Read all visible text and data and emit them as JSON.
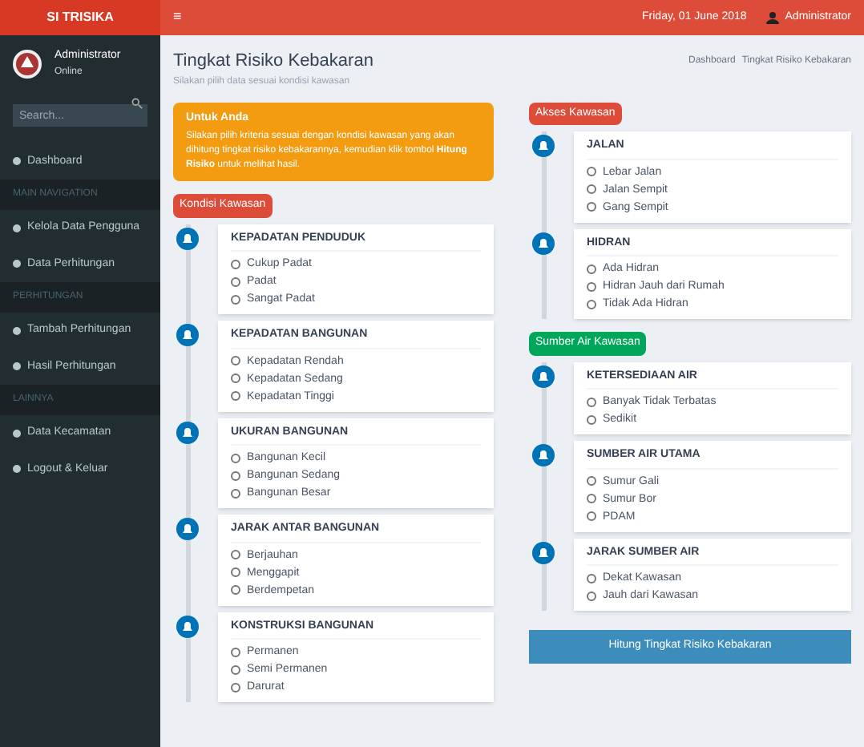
{
  "header": {
    "logo": "SI TRISIKA",
    "menu_toggle": "≡",
    "date": "Friday, 01 June 2018",
    "user": "Administrator"
  },
  "sidebar": {
    "user_name": "Administrator",
    "user_status": "Online",
    "search": {
      "placeholder": "Search..."
    },
    "items": [
      {
        "kind": "item",
        "label": "Dashboard",
        "selected": false
      },
      {
        "kind": "section",
        "label": "MAIN NAVIGATION"
      },
      {
        "kind": "item",
        "label": "Kelola Data Pengguna",
        "selected": false
      },
      {
        "kind": "item",
        "label": "Data Perhitungan",
        "selected": false
      },
      {
        "kind": "section",
        "label": "PERHITUNGAN"
      },
      {
        "kind": "item",
        "label": "Tambah Perhitungan",
        "selected": false
      },
      {
        "kind": "item",
        "label": "Hasil Perhitungan",
        "selected": false
      },
      {
        "kind": "section",
        "label": "LAINNYA"
      },
      {
        "kind": "item",
        "label": "Data Kecamatan",
        "selected": false
      },
      {
        "kind": "item",
        "label": "Logout & Keluar",
        "selected": false
      }
    ]
  },
  "page": {
    "title": "Tingkat Risiko Kebakaran",
    "subtitle": "Silakan pilih data sesuai kondisi kawasan",
    "breadcrumb": [
      "Dashboard",
      "Tingkat Risiko Kebakaran"
    ]
  },
  "alert": {
    "title": "Untuk Anda",
    "text": "Silakan pilih kriteria sesuai dengan kondisi kawasan yang akan dihitung tingkat risiko kebakarannya, kemudian klik tombol **Hitung Risiko** untuk melihat hasil."
  },
  "left_groups": [
    {
      "label": "Kondisi Kawasan",
      "color": "#dd4b39",
      "cards": [
        {
          "title": "KEPADATAN PENDUDUK",
          "options": [
            {
              "label": "Cukup Padat",
              "selected": false
            },
            {
              "label": "Padat",
              "selected": false
            },
            {
              "label": "Sangat Padat",
              "selected": false
            }
          ]
        },
        {
          "title": "KEPADATAN BANGUNAN",
          "options": [
            {
              "label": "Kepadatan Rendah",
              "selected": false
            },
            {
              "label": "Kepadatan Sedang",
              "selected": false
            },
            {
              "label": "Kepadatan Tinggi",
              "selected": false
            }
          ]
        },
        {
          "title": "UKURAN BANGUNAN",
          "options": [
            {
              "label": "Bangunan Kecil",
              "selected": false
            },
            {
              "label": "Bangunan Sedang",
              "selected": false
            },
            {
              "label": "Bangunan Besar",
              "selected": false
            }
          ]
        },
        {
          "title": "JARAK ANTAR BANGUNAN",
          "options": [
            {
              "label": "Berjauhan",
              "selected": false
            },
            {
              "label": "Menggapit",
              "selected": false
            },
            {
              "label": "Berdempetan",
              "selected": false
            }
          ]
        },
        {
          "title": "KONSTRUKSI BANGUNAN",
          "options": [
            {
              "label": "Permanen",
              "selected": false
            },
            {
              "label": "Semi Permanen",
              "selected": false
            },
            {
              "label": "Darurat",
              "selected": false
            }
          ]
        }
      ]
    }
  ],
  "right_groups": [
    {
      "label": "Akses Kawasan",
      "color": "#dd4b39",
      "cards": [
        {
          "title": "JALAN",
          "options": [
            {
              "label": "Lebar Jalan",
              "selected": false
            },
            {
              "label": "Jalan Sempit",
              "selected": false
            },
            {
              "label": "Gang Sempit",
              "selected": false
            }
          ]
        },
        {
          "title": "HIDRAN",
          "options": [
            {
              "label": "Ada Hidran",
              "selected": false
            },
            {
              "label": "Hidran Jauh dari Rumah",
              "selected": false
            },
            {
              "label": "Tidak Ada Hidran",
              "selected": false
            }
          ]
        }
      ]
    },
    {
      "label": "Sumber Air Kawasan",
      "color": "#00a65a",
      "cards": [
        {
          "title": "KETERSEDIAAN AIR",
          "options": [
            {
              "label": "Banyak Tidak Terbatas",
              "selected": false
            },
            {
              "label": "Sedikit",
              "selected": false
            }
          ]
        },
        {
          "title": "SUMBER AIR UTAMA",
          "options": [
            {
              "label": "Sumur Gali",
              "selected": false
            },
            {
              "label": "Sumur Bor",
              "selected": false
            },
            {
              "label": "PDAM",
              "selected": false
            }
          ]
        },
        {
          "title": "JARAK SUMBER AIR",
          "options": [
            {
              "label": "Dekat Kawasan",
              "selected": false
            },
            {
              "label": "Jauh dari Kawasan",
              "selected": false
            }
          ]
        }
      ]
    }
  ],
  "submit": "Hitung Tingkat Risiko Kebakaran"
}
